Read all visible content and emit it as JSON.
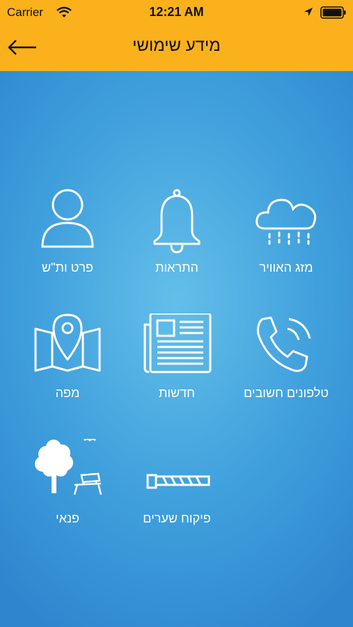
{
  "status": {
    "carrier": "Carrier",
    "time": "12:21 AM"
  },
  "nav": {
    "title": "מידע שימושי"
  },
  "tiles": [
    {
      "label": "מזג האוויר",
      "icon": "cloud-rain-icon"
    },
    {
      "label": "התראות",
      "icon": "bell-icon"
    },
    {
      "label": "פרט ות\"ש",
      "icon": "person-icon"
    },
    {
      "label": "טלפונים חשובים",
      "icon": "phone-icon"
    },
    {
      "label": "חדשות",
      "icon": "newspaper-icon"
    },
    {
      "label": "מפה",
      "icon": "map-pin-icon"
    },
    {
      "label": "פיקוח שערים",
      "icon": "barrier-gate-icon"
    },
    {
      "label": "פנאי",
      "icon": "park-bench-icon"
    }
  ],
  "colors": {
    "header": "#fbb11b",
    "bg_center": "#63bfe9",
    "bg_edge": "#2f86cf"
  }
}
